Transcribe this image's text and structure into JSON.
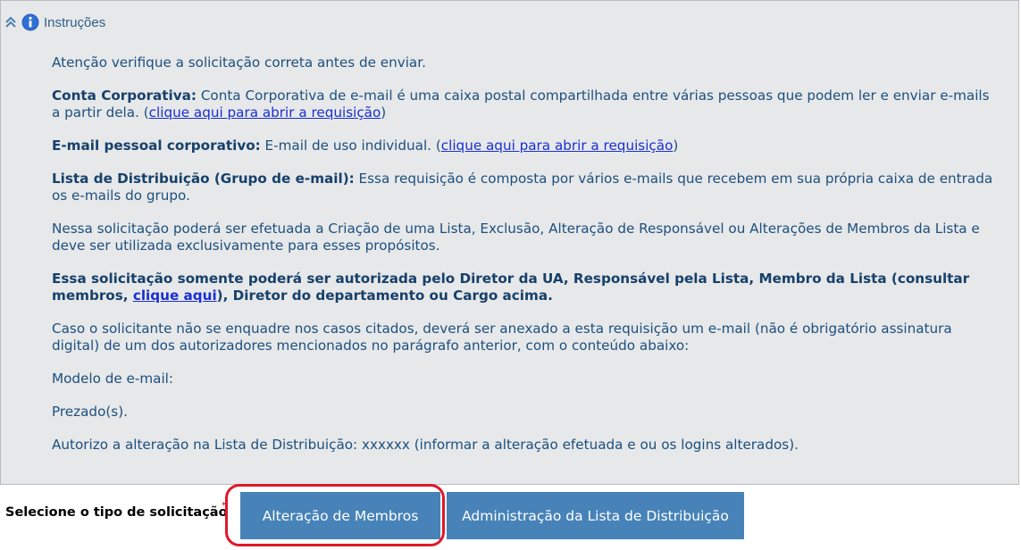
{
  "panel": {
    "title": "Instruções",
    "collapse_icon": "double-chevron-up-icon",
    "info_icon": "info-icon",
    "accent_color": "#1e4f7d",
    "link_color": "#1a2fd0"
  },
  "instructions": {
    "p1": "Atenção verifique a solicitação correta antes de enviar.",
    "p2_bold": "Conta Corporativa:",
    "p2_text": " Conta Corporativa de e-mail é uma caixa postal compartilhada entre várias pessoas que podem ler e enviar e-mails a partir dela. (",
    "p2_link": "clique aqui para abrir a requisição",
    "p2_end": ")",
    "p3_bold": "E-mail pessoal corporativo:",
    "p3_text": " E-mail de uso individual. (",
    "p3_link": "clique aqui para abrir a requisição",
    "p3_end": ")",
    "p4_bold": "Lista de Distribuição (Grupo de e-mail):",
    "p4_text": " Essa requisição é composta por vários e-mails que recebem em sua própria caixa de entrada os e-mails do grupo.",
    "p5": "Nessa solicitação poderá ser efetuada a Criação de uma Lista, Exclusão, Alteração de Responsável ou Alterações de Membros da Lista e deve ser utilizada exclusivamente para esses propósitos.",
    "p6_bold_start": "Essa solicitação somente poderá ser autorizada pelo Diretor da UA, Responsável pela Lista, Membro da Lista (consultar membros, ",
    "p6_link": "clique aqui",
    "p6_bold_end": "), Diretor do departamento ou Cargo acima.",
    "p7": "Caso o solicitante não se enquadre nos casos citados, deverá ser anexado a esta requisição um e-mail (não é obrigatório assinatura digital) de um dos autorizadores mencionados no parágrafo anterior, com o conteúdo abaixo:",
    "p8": "Modelo de e-mail:",
    "p9": "Prezado(s).",
    "p10": "Autorizo a alteração na Lista de Distribuição: xxxxxx (informar a alteração efetuada e ou os logins alterados)."
  },
  "request_type": {
    "label": "Selecione o tipo de solicitação",
    "required_mark": "*",
    "buttons": [
      {
        "label": "Alteração de Membros",
        "highlighted": true
      },
      {
        "label": "Administração da Lista de Distribuição",
        "highlighted": false
      }
    ],
    "button_color": "#4783b8",
    "highlight_color": "#e0182a"
  }
}
